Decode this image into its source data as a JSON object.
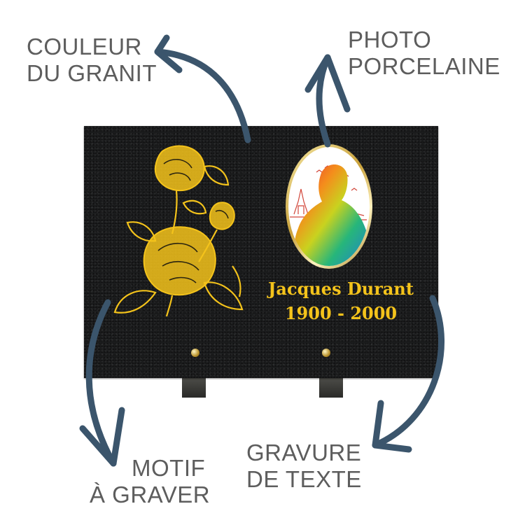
{
  "labels": {
    "granit": [
      "COULEUR",
      "DU GRANIT"
    ],
    "photo": [
      "PHOTO",
      "PORCELAINE"
    ],
    "motif": [
      "MOTIF",
      "À GRAVER"
    ],
    "texte": [
      "GRAVURE",
      "DE TEXTE"
    ]
  },
  "plaque": {
    "name": "Jacques Durant",
    "dates": "1900 - 2000"
  },
  "icons": [
    "rose-motif-icon",
    "porcelain-photo-icon",
    "arrow-icon"
  ],
  "colors": {
    "label_text": "#5d5d5d",
    "arrow": "#3b556c",
    "granite": "#1b1c1d",
    "engraving_gold": "#f4c31b"
  }
}
